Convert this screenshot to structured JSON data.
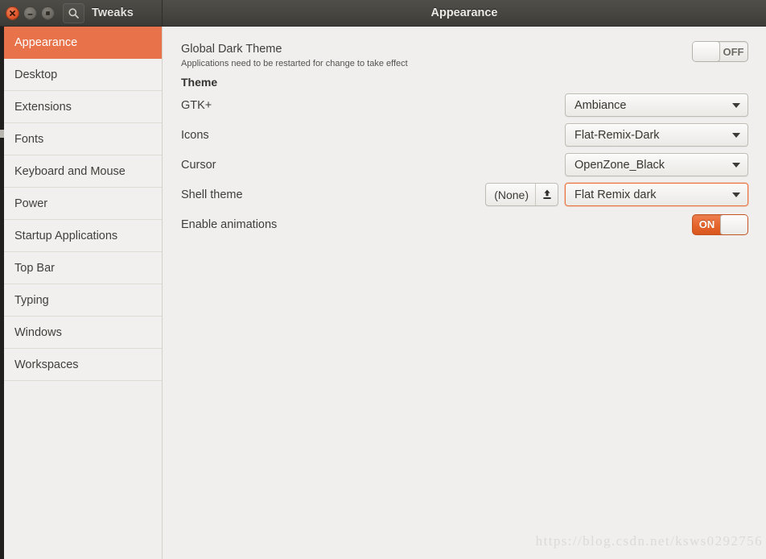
{
  "window": {
    "app_name": "Tweaks",
    "page_title": "Appearance",
    "controls": {
      "close": "close-button",
      "minimize": "minimize-button",
      "maximize": "maximize-button"
    },
    "search_icon": "search-icon"
  },
  "sidebar": {
    "items": [
      {
        "label": "Appearance",
        "selected": true
      },
      {
        "label": "Desktop",
        "selected": false
      },
      {
        "label": "Extensions",
        "selected": false
      },
      {
        "label": "Fonts",
        "selected": false
      },
      {
        "label": "Keyboard and Mouse",
        "selected": false
      },
      {
        "label": "Power",
        "selected": false
      },
      {
        "label": "Startup Applications",
        "selected": false
      },
      {
        "label": "Top Bar",
        "selected": false
      },
      {
        "label": "Typing",
        "selected": false
      },
      {
        "label": "Windows",
        "selected": false
      },
      {
        "label": "Workspaces",
        "selected": false
      }
    ]
  },
  "content": {
    "global_dark": {
      "title": "Global Dark Theme",
      "subtitle": "Applications need to be restarted for change to take effect",
      "toggle_state": "OFF"
    },
    "section_theme": "Theme",
    "rows": {
      "gtk": {
        "label": "GTK+",
        "value": "Ambiance"
      },
      "icons": {
        "label": "Icons",
        "value": "Flat-Remix-Dark"
      },
      "cursor": {
        "label": "Cursor",
        "value": "OpenZone_Black"
      },
      "shell": {
        "label": "Shell theme",
        "file_value": "(None)",
        "upload_icon": "upload-icon",
        "value": "Flat Remix dark"
      },
      "animations": {
        "label": "Enable animations",
        "toggle_state": "ON"
      }
    }
  },
  "watermark": "https://blog.csdn.net/ksws0292756",
  "colors": {
    "accent_orange": "#e8734a",
    "titlebar_dark": "#45433d",
    "surface": "#f0efed",
    "text": "#3f3e3a"
  }
}
